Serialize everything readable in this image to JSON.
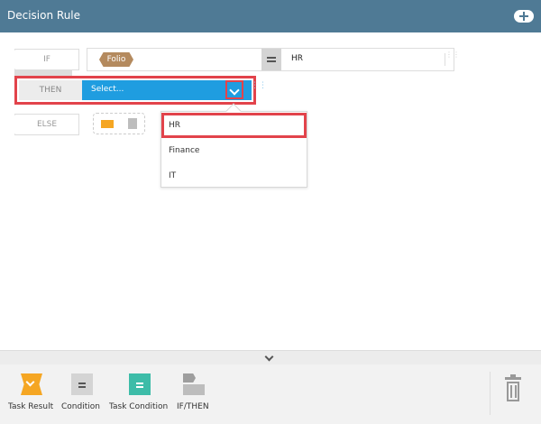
{
  "header": {
    "title": "Decision Rule",
    "add_icon": "plus-circle-icon"
  },
  "rule": {
    "if_label": "IF",
    "then_label": "THEN",
    "else_label": "ELSE",
    "if_field": "Folio",
    "operator": "=",
    "if_value": "HR",
    "then_placeholder": "Select..."
  },
  "dropdown": {
    "options": [
      {
        "label": "HR",
        "selected": true
      },
      {
        "label": "Finance",
        "selected": false
      },
      {
        "label": "IT",
        "selected": false
      }
    ]
  },
  "toolbar": {
    "items": [
      {
        "label": "Task Result",
        "icon": "task-result-icon"
      },
      {
        "label": "Condition",
        "icon": "condition-icon"
      },
      {
        "label": "Task Condition",
        "icon": "task-condition-icon"
      },
      {
        "label": "IF/THEN",
        "icon": "if-then-icon"
      }
    ],
    "delete_icon": "trash-icon"
  },
  "colors": {
    "header_bg": "#4f7a95",
    "select_bg": "#1f9de0",
    "highlight": "#e2434b",
    "folio": "#b48a5e",
    "task_result": "#f5a623",
    "task_condition": "#3dbca8"
  }
}
